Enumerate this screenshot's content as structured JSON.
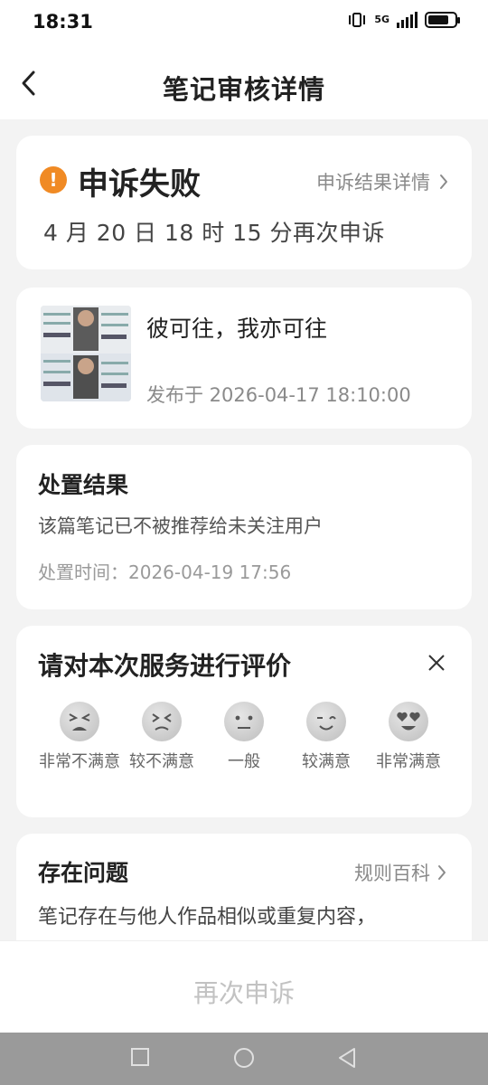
{
  "status_bar": {
    "time": "18:31",
    "network": "5G"
  },
  "header": {
    "title": "笔记审核详情",
    "back_icon": "chevron-left-icon"
  },
  "appeal": {
    "status": "申诉失败",
    "status_color": "#f08a24",
    "detail_link": "申诉结果详情",
    "date_text": "4 月 20 日 18 时 15 分再次申诉"
  },
  "note": {
    "title": "彼可往，我亦可往",
    "publish_text": "发布于 2026-04-17 18:10:00"
  },
  "result": {
    "title": "处置结果",
    "description": "该篇笔记已不被推荐给未关注用户",
    "time_text": "处置时间：2026-04-19 17:56"
  },
  "rating": {
    "title": "请对本次服务进行评价",
    "options": [
      {
        "label": "非常不满意",
        "icon": "very-unsatisfied-face-icon"
      },
      {
        "label": "较不满意",
        "icon": "unsatisfied-face-icon"
      },
      {
        "label": "一般",
        "icon": "neutral-face-icon"
      },
      {
        "label": "较满意",
        "icon": "satisfied-face-icon"
      },
      {
        "label": "非常满意",
        "icon": "very-satisfied-face-icon"
      }
    ]
  },
  "issue": {
    "title": "存在问题",
    "link": "规则百科",
    "description": "笔记存在与他人作品相似或重复内容，"
  },
  "bottom": {
    "button": "再次申诉"
  }
}
